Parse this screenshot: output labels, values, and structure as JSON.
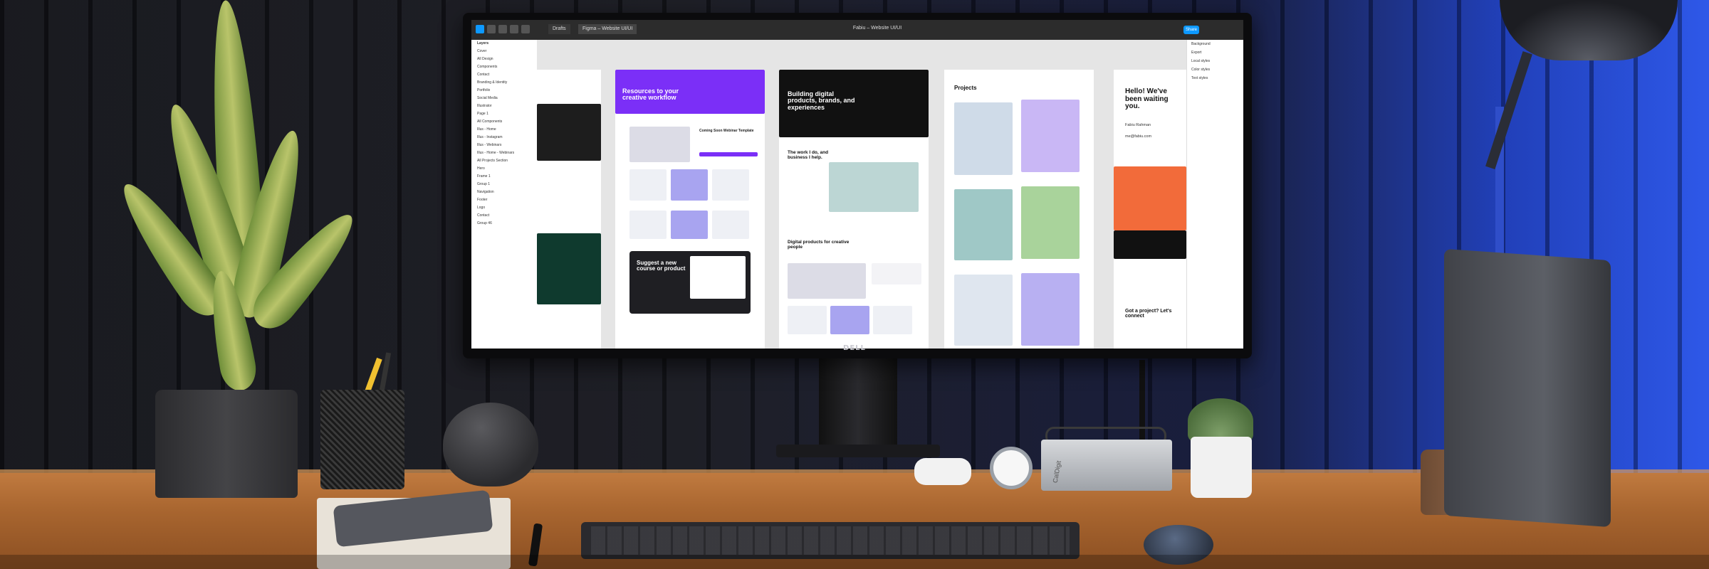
{
  "monitor": {
    "brand": "DELL"
  },
  "figma": {
    "file_title": "Fabiu – Website UI/UI",
    "tabs": [
      "Drafts",
      "Figma – Website UI/UI"
    ],
    "share_label": "Share",
    "layers_title": "Layers",
    "layers": [
      "Cover",
      "All Design",
      "Components",
      "Contact",
      "Branding & Identity",
      "Portfolio",
      "Social Media",
      "Illustrator",
      "Page 1",
      "All Components",
      "Illus - Home",
      "Illus - Instagram",
      "Illus - Webinars",
      "Illus - Home - Webinars",
      "All Projects Section",
      "Hero",
      "Frame 1",
      "Group 1",
      "Navigation",
      "Footer",
      "Logo",
      "Contact",
      "Group 46"
    ],
    "props": [
      "Background",
      "Export",
      "Local styles",
      "Color styles",
      "Text styles"
    ],
    "frames": {
      "resources_heading": "Resources to your creative workflow",
      "suggest_heading": "Suggest a new course or product",
      "building_heading": "Building digital products, brands, and experiences",
      "work_heading": "The work I do, and business I help.",
      "digital_heading": "Digital products for creative people",
      "coming_soon": "Coming Soon Webinar Template",
      "projects_heading": "Projects",
      "hello_heading": "Hello! We've been waiting you.",
      "contact_name": "Fabiu Rahman",
      "contact_email": "me@fabiu.com",
      "got_project": "Got a project? Let's connect"
    }
  },
  "dock_brand": "CalDigit"
}
